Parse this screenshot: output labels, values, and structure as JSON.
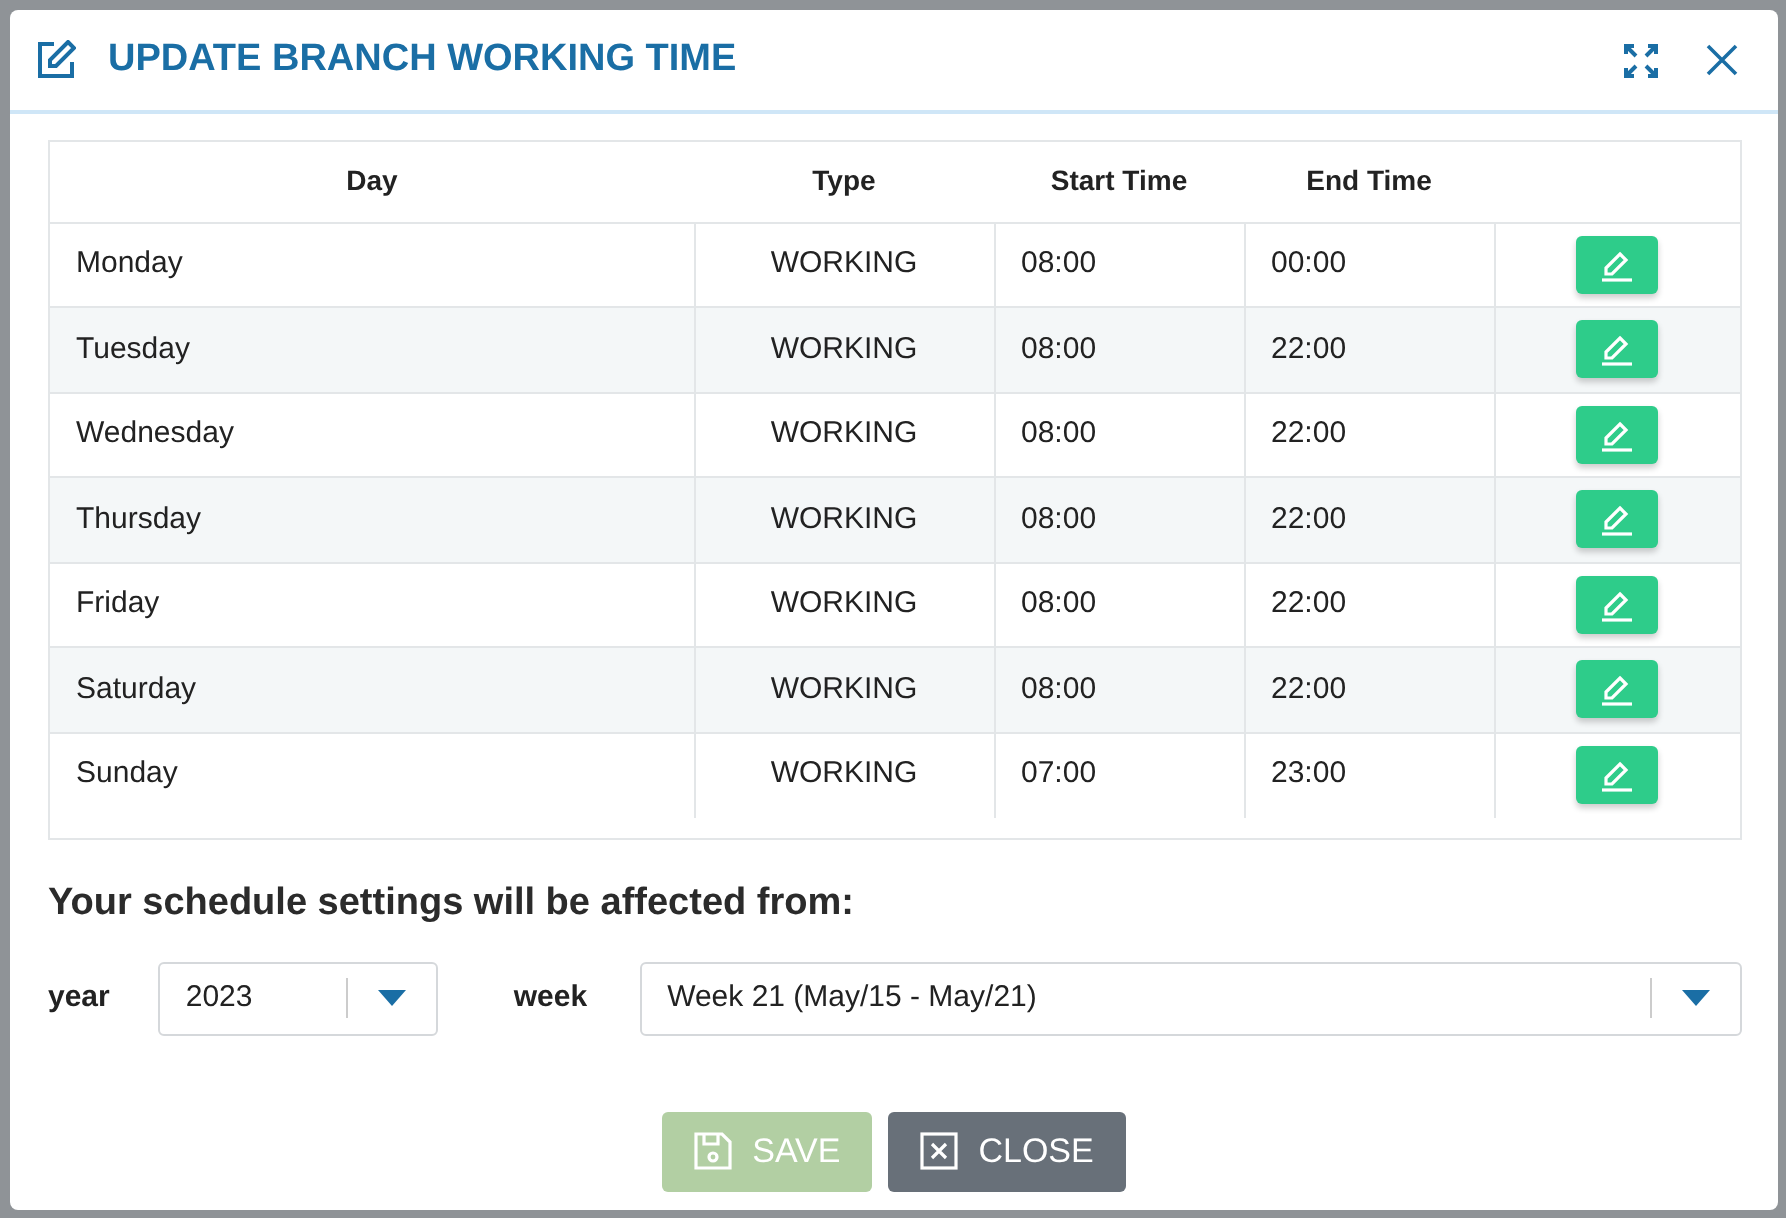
{
  "dialog": {
    "title": "UPDATE BRANCH WORKING TIME"
  },
  "table": {
    "columns": [
      "Day",
      "Type",
      "Start Time",
      "End Time"
    ],
    "rows": [
      {
        "day": "Monday",
        "type": "WORKING",
        "start": "08:00",
        "end": "00:00"
      },
      {
        "day": "Tuesday",
        "type": "WORKING",
        "start": "08:00",
        "end": "22:00"
      },
      {
        "day": "Wednesday",
        "type": "WORKING",
        "start": "08:00",
        "end": "22:00"
      },
      {
        "day": "Thursday",
        "type": "WORKING",
        "start": "08:00",
        "end": "22:00"
      },
      {
        "day": "Friday",
        "type": "WORKING",
        "start": "08:00",
        "end": "22:00"
      },
      {
        "day": "Saturday",
        "type": "WORKING",
        "start": "08:00",
        "end": "22:00"
      },
      {
        "day": "Sunday",
        "type": "WORKING",
        "start": "07:00",
        "end": "23:00"
      }
    ]
  },
  "schedule": {
    "heading": "Your schedule settings will be affected from:",
    "year_label": "year",
    "year": "2023",
    "week_label": "week",
    "week": "Week 21 (May/15 - May/21)"
  },
  "buttons": [
    {
      "label": "SAVE",
      "kind": "save",
      "disabled": true
    },
    {
      "label": "CLOSE",
      "kind": "close",
      "disabled": false
    }
  ]
}
